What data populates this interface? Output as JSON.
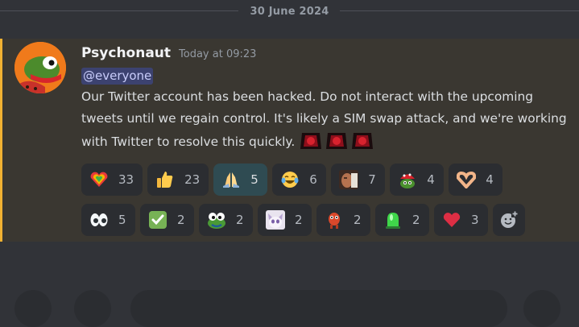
{
  "date_divider": "30 June 2024",
  "message": {
    "author": "Psychonaut",
    "timestamp": "Today at 09:23",
    "mention": "@everyone",
    "text": "Our Twitter account has been hacked. Do not interact with the upcoming tweets until we regain control. It's likely a SIM swap attack, and we're working with Twitter to resolve this quickly.",
    "accent_color": "#f0b132"
  },
  "reactions_row1": [
    {
      "icon": "rainbow-heart-icon",
      "count": "33"
    },
    {
      "icon": "thumbs-up-icon",
      "count": "23"
    },
    {
      "icon": "folded-hands-icon",
      "count": "5",
      "active": true
    },
    {
      "icon": "tears-of-joy-icon",
      "count": "6"
    },
    {
      "icon": "face-photo-icon",
      "count": "7"
    },
    {
      "icon": "frog-cap-icon",
      "count": "4"
    },
    {
      "icon": "heart-hands-icon",
      "count": "4"
    }
  ],
  "reactions_row2": [
    {
      "icon": "eyes-icon",
      "count": "5"
    },
    {
      "icon": "check-mark-icon",
      "count": "2"
    },
    {
      "icon": "frog-eyes-icon",
      "count": "2"
    },
    {
      "icon": "anime-cat-icon",
      "count": "2"
    },
    {
      "icon": "red-creature-icon",
      "count": "2"
    },
    {
      "icon": "green-siren-icon",
      "count": "2"
    },
    {
      "icon": "red-heart-icon",
      "count": "3"
    }
  ]
}
